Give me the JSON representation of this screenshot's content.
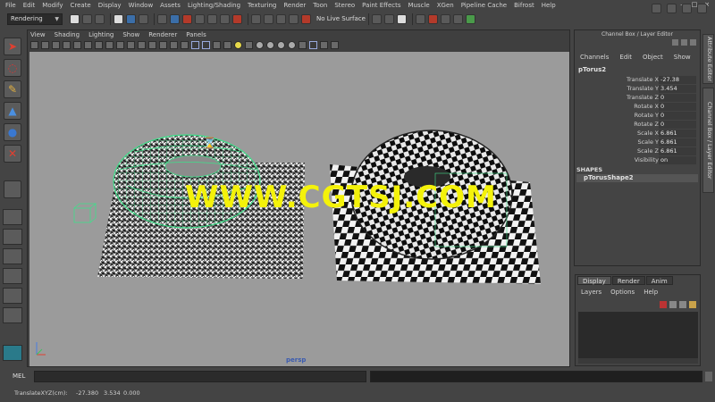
{
  "menu": [
    "File",
    "Edit",
    "Modify",
    "Create",
    "Display",
    "Window",
    "Assets",
    "Lighting/Shading",
    "Texturing",
    "Render",
    "Toon",
    "Stereo",
    "Paint Effects",
    "Muscle",
    "XGen",
    "Pipeline Cache",
    "Bifrost",
    "Help"
  ],
  "window_controls": {
    "minimize": "–",
    "maximize": "□",
    "close": "×"
  },
  "status_line": {
    "mode": "Rendering",
    "live_surface": "No Live Surface"
  },
  "panel": {
    "menu": [
      "View",
      "Shading",
      "Lighting",
      "Show",
      "Renderer",
      "Panels"
    ],
    "camera_label": "persp"
  },
  "watermark": "WWW.CGTSJ.COM",
  "channel_box": {
    "title": "Channel Box / Layer Editor",
    "menu": [
      "Channels",
      "Edit",
      "Object",
      "Show"
    ],
    "node": "pTorus2",
    "attributes": [
      {
        "label": "Translate X",
        "value": "-27.38"
      },
      {
        "label": "Translate Y",
        "value": "3.454"
      },
      {
        "label": "Translate Z",
        "value": "0"
      },
      {
        "label": "Rotate X",
        "value": "0"
      },
      {
        "label": "Rotate Y",
        "value": "0"
      },
      {
        "label": "Rotate Z",
        "value": "0"
      },
      {
        "label": "Scale X",
        "value": "6.861"
      },
      {
        "label": "Scale Y",
        "value": "6.861"
      },
      {
        "label": "Scale Z",
        "value": "6.861"
      },
      {
        "label": "Visibility",
        "value": "on"
      }
    ],
    "shapes_header": "SHAPES",
    "shape": "pTorusShape2"
  },
  "side_tabs": [
    "Attribute Editor",
    "Channel Box / Layer Editor"
  ],
  "layer_editor": {
    "tabs": [
      "Display",
      "Render",
      "Anim"
    ],
    "menu": [
      "Layers",
      "Options",
      "Help"
    ]
  },
  "command_line": {
    "label": "MEL"
  },
  "help_line": {
    "label": "TranslateXYZ(cm):",
    "x": "-27.380",
    "y": "3.534",
    "z": "0.000"
  },
  "colors": {
    "watermark": "#f4f20a",
    "wireframe_selected": "#3ee08a",
    "viewport_bg": "#9b9b9b"
  }
}
